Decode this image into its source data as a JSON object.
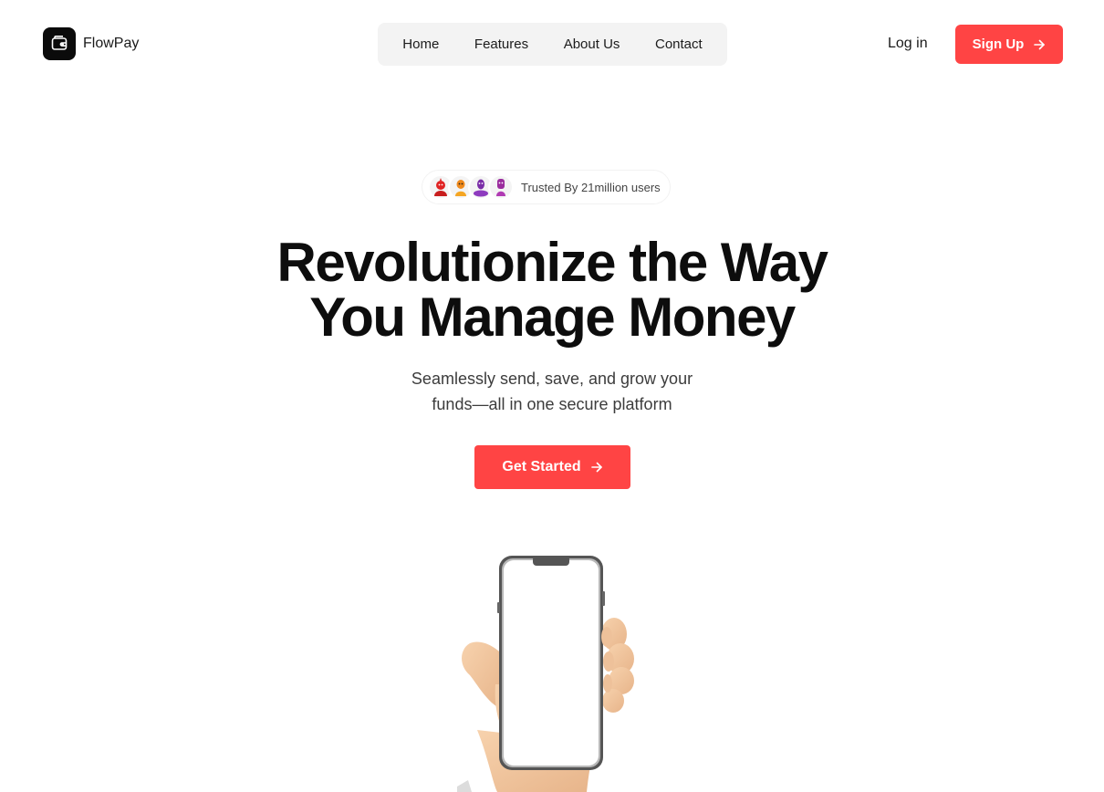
{
  "brand": {
    "name": "FlowPay",
    "icon": "wallet-icon"
  },
  "nav": {
    "items": [
      {
        "label": "Home"
      },
      {
        "label": "Features"
      },
      {
        "label": "About Us"
      },
      {
        "label": "Contact"
      }
    ]
  },
  "header": {
    "login_label": "Log in",
    "signup_label": "Sign Up",
    "signup_icon": "arrow-right-icon"
  },
  "hero": {
    "trust_text": "Trusted By 21million users",
    "headline_line1": "Revolutionize the Way",
    "headline_line2": "You Manage Money",
    "subtext_line1": "Seamlessly send, save, and grow your",
    "subtext_line2": "funds—all in one secure platform",
    "cta_label": "Get Started",
    "cta_icon": "arrow-right-icon",
    "illustration": "hand-holding-phone-illustration"
  },
  "colors": {
    "accent": "#ff4444",
    "nav_background": "#f3f3f3",
    "logo_background": "#0b0b0b",
    "text_dark": "#0d0d0d"
  }
}
